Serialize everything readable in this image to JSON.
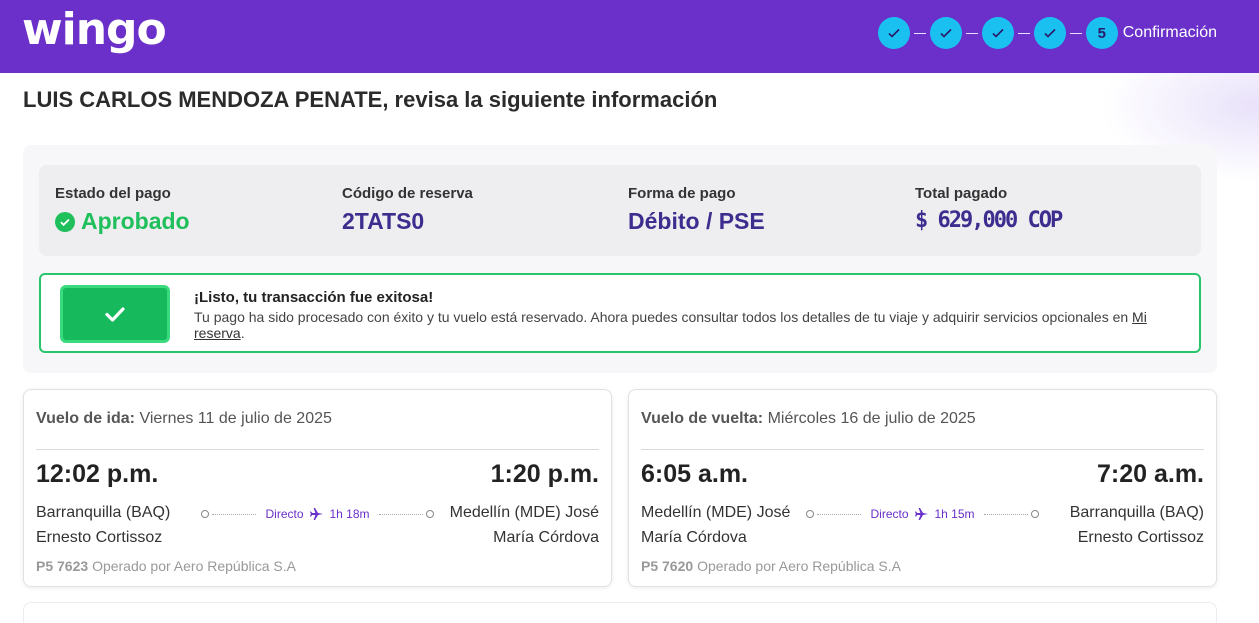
{
  "header": {
    "logo": "wingo",
    "steps": [
      {
        "state": "done",
        "icon": "check-icon"
      },
      {
        "state": "done",
        "icon": "check-icon"
      },
      {
        "state": "done",
        "icon": "check-icon"
      },
      {
        "state": "done",
        "icon": "check-icon"
      },
      {
        "state": "current",
        "number": "5"
      }
    ],
    "current_step_label": "Confirmación"
  },
  "greeting": "LUIS CARLOS MENDOZA PENATE, revisa la siguiente información",
  "summary": {
    "payment_status_label": "Estado del pago",
    "payment_status_value": "Aprobado",
    "reservation_code_label": "Código de reserva",
    "reservation_code_value": "2TATS0",
    "payment_method_label": "Forma de pago",
    "payment_method_value": "Débito / PSE",
    "total_label": "Total pagado",
    "total_value": "$ 629,000 COP"
  },
  "success": {
    "title": "¡Listo, tu transacción fue exitosa!",
    "text": "Tu pago ha sido procesado con éxito y tu vuelo está reservado. Ahora puedes consultar todos los detalles de tu viaje y adquirir servicios opcionales en ",
    "link": "Mi reserva",
    "text_end": "."
  },
  "flights": [
    {
      "label": "Vuelo de ida:",
      "date": "Viernes 11 de julio de 2025",
      "depart_time": "12:02 p.m.",
      "arrive_time": "1:20 p.m.",
      "origin": "Barranquilla (BAQ) Ernesto Cortissoz",
      "destination": "Medellín (MDE) José María Córdova",
      "type": "Directo",
      "duration": "1h 18m",
      "flight_number": "P5 7623",
      "operator": "Operado por Aero República S.A"
    },
    {
      "label": "Vuelo de vuelta:",
      "date": "Miércoles 16 de julio de 2025",
      "depart_time": "6:05 a.m.",
      "arrive_time": "7:20 a.m.",
      "origin": "Medellín (MDE) José María Córdova",
      "destination": "Barranquilla (BAQ) Ernesto Cortissoz",
      "type": "Directo",
      "duration": "1h 15m",
      "flight_number": "P5 7620",
      "operator": "Operado por Aero República S.A"
    }
  ],
  "colors": {
    "brand": "#6a30c9",
    "step": "#1ac0f0",
    "success": "#1fbf5c"
  }
}
